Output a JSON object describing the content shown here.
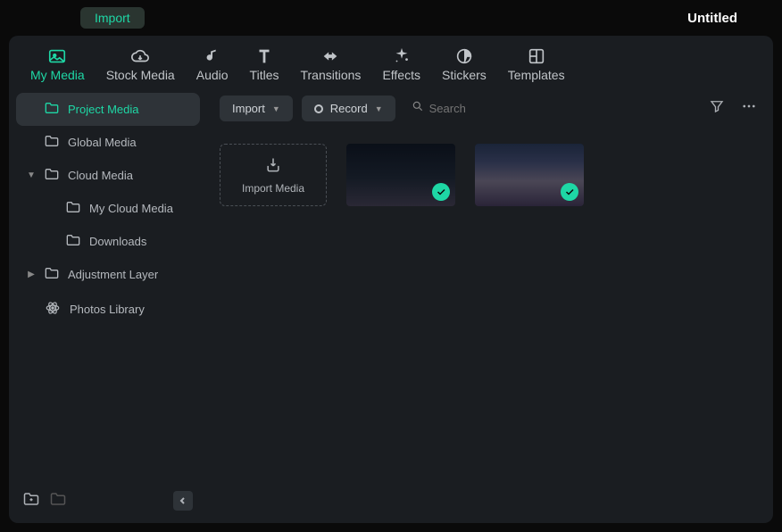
{
  "header": {
    "import_label": "Import",
    "project_title": "Untitled"
  },
  "tabs": [
    {
      "id": "my-media",
      "label": "My Media",
      "active": true
    },
    {
      "id": "stock-media",
      "label": "Stock Media"
    },
    {
      "id": "audio",
      "label": "Audio"
    },
    {
      "id": "titles",
      "label": "Titles"
    },
    {
      "id": "transitions",
      "label": "Transitions"
    },
    {
      "id": "effects",
      "label": "Effects"
    },
    {
      "id": "stickers",
      "label": "Stickers"
    },
    {
      "id": "templates",
      "label": "Templates"
    }
  ],
  "sidebar": {
    "items": [
      {
        "label": "Project Media",
        "selected": true
      },
      {
        "label": "Global Media"
      },
      {
        "label": "Cloud Media",
        "expanded": true
      },
      {
        "label": "My Cloud Media",
        "child": true
      },
      {
        "label": "Downloads",
        "child": true
      },
      {
        "label": "Adjustment Layer",
        "expandable": true
      },
      {
        "label": "Photos Library",
        "icon": "atom"
      }
    ]
  },
  "toolbar": {
    "import_label": "Import",
    "record_label": "Record",
    "search_placeholder": "Search"
  },
  "grid": {
    "import_tile_label": "Import Media",
    "thumbs": [
      {
        "name": "media-thumb-1",
        "checked": true
      },
      {
        "name": "media-thumb-2",
        "checked": true
      }
    ]
  }
}
